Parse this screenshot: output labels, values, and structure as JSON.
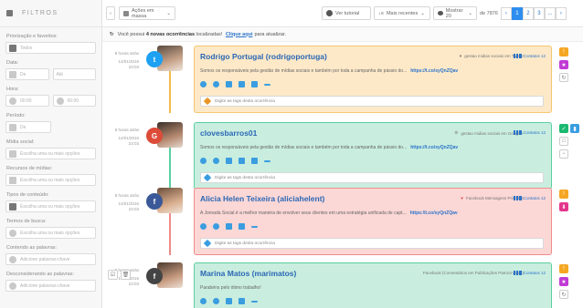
{
  "sidebar": {
    "title": "FILTROS",
    "sections": [
      {
        "label": "Priorização e favoritos:",
        "placeholder": "Todos"
      },
      {
        "label": "Data:",
        "from": "De",
        "to": "Até"
      },
      {
        "label": "Hora:",
        "from": "00:00",
        "to": "00:00"
      },
      {
        "label": "Período:",
        "placeholder": "De"
      },
      {
        "label": "Mídia social:",
        "placeholder": "Escolha uma ou mais opções"
      },
      {
        "label": "Recursos de mídias:",
        "placeholder": "Escolha uma ou mais opções"
      },
      {
        "label": "Tipos de conteúdo:",
        "placeholder": "Escolha uma ou mais opções"
      },
      {
        "label": "Termos de busca:",
        "placeholder": "Escolha uma ou mais opções"
      },
      {
        "label": "Contendo as palavras:",
        "placeholder": "Adicione palavras-chave"
      },
      {
        "label": "Desconsiderando as palavras:",
        "placeholder": "Adicione palavras-chave"
      }
    ]
  },
  "topbar": {
    "bulk_label": "Ações em massa",
    "tutorial_label": "Ver tutorial",
    "sort_label": "Mais recentes",
    "show_label": "Mostrar 20",
    "range_label": "de 7876",
    "pages": [
      "1",
      "2",
      "3",
      "..."
    ]
  },
  "notice": {
    "prefix": "Você possui",
    "count": "4 novas ocorrências",
    "middle": "localizadas!",
    "link": "Clique aqui",
    "suffix": "para atualizar."
  },
  "cards": [
    {
      "time": "8 horas atrás",
      "date": "14/01/2016",
      "clock": "23:03",
      "name": "Rodrigo Portugal (rodrigoportuga)",
      "source": "gestao midias sociais em Twitter",
      "contacts": "Contatos 12",
      "text": "Somos os responsáveis pela gestão de mídias sociais e também por toda a campanha de pássio do...",
      "link": "https://t.co/syQnZQav",
      "tag_placeholder": "Digite as tags desta ocorrência",
      "network": "twitter",
      "color": "#f9e3bf",
      "border": "#f5c66e"
    },
    {
      "time": "8 horas atrás",
      "date": "14/01/2016",
      "clock": "23:03",
      "name": "clovesbarros01",
      "source": "gestao midias sociais em Google+",
      "contacts": "Contatos 12",
      "text": "Somos os responsáveis pela gestão de mídias sociais e também por toda a campanha de pássio do...",
      "link": "https://t.co/syQnZQav",
      "tag_placeholder": "Digite as tags desta ocorrência",
      "network": "google",
      "color": "#c5ecdc",
      "border": "#5ccfa0"
    },
    {
      "time": "8 horas atrás",
      "date": "14/01/2016",
      "clock": "23:03",
      "name": "Alicia Helen Teixeira (aliciahelent)",
      "source": "Facebook Mensagens Privadas",
      "contacts": "Contatos 12",
      "text": "A Jornada Social é a melhor maneira de envolver seus clientes em uma estratégia unificada de capt...",
      "link": "https://t.co/syQnZQav",
      "tag_placeholder": "Digite as tags desta ocorrência",
      "network": "facebook",
      "color": "#f9d3d2",
      "border": "#ef8c8a"
    },
    {
      "time": "8 horas atrás",
      "date": "14/01/2016",
      "clock": "23:03",
      "name": "Marina Matos (marimatos)",
      "source": "Facebook (Comentários em Publicações Patrocinadas)",
      "contacts": "Contatos 12",
      "text": "Parabéns pelo ótimo trabalho!",
      "link": "",
      "tag_placeholder": "",
      "network": "facebook-dark",
      "color": "#c5ecdc",
      "border": "#5ccfa0"
    }
  ],
  "colors": {
    "accent": "#2d8ef0",
    "twitter": "#1da1f2",
    "google": "#dd4b39",
    "facebook": "#3b5998"
  }
}
